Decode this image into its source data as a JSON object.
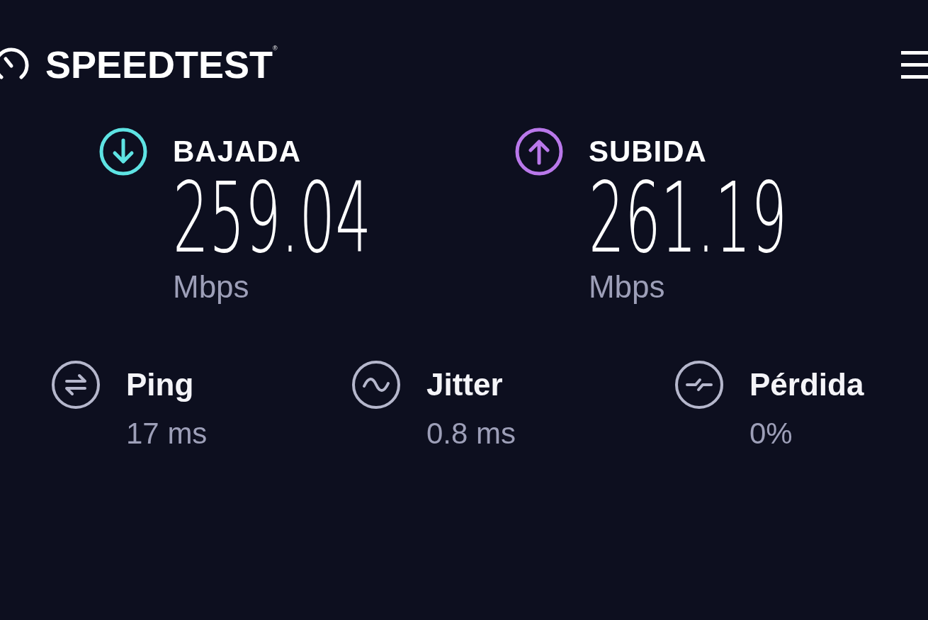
{
  "header": {
    "logo_text": "SPEEDTEST",
    "trademark": "®"
  },
  "speeds": [
    {
      "kind": "download",
      "label": "BAJADA",
      "value": "259.04",
      "unit": "Mbps",
      "color": "#5ee3e3"
    },
    {
      "kind": "upload",
      "label": "SUBIDA",
      "value": "261.19",
      "unit": "Mbps",
      "color": "#b978ea"
    }
  ],
  "metrics": [
    {
      "kind": "ping",
      "label": "Ping",
      "value": "17 ms"
    },
    {
      "kind": "jitter",
      "label": "Jitter",
      "value": "0.8 ms"
    },
    {
      "kind": "loss",
      "label": "Pérdida",
      "value": "0%"
    }
  ]
}
